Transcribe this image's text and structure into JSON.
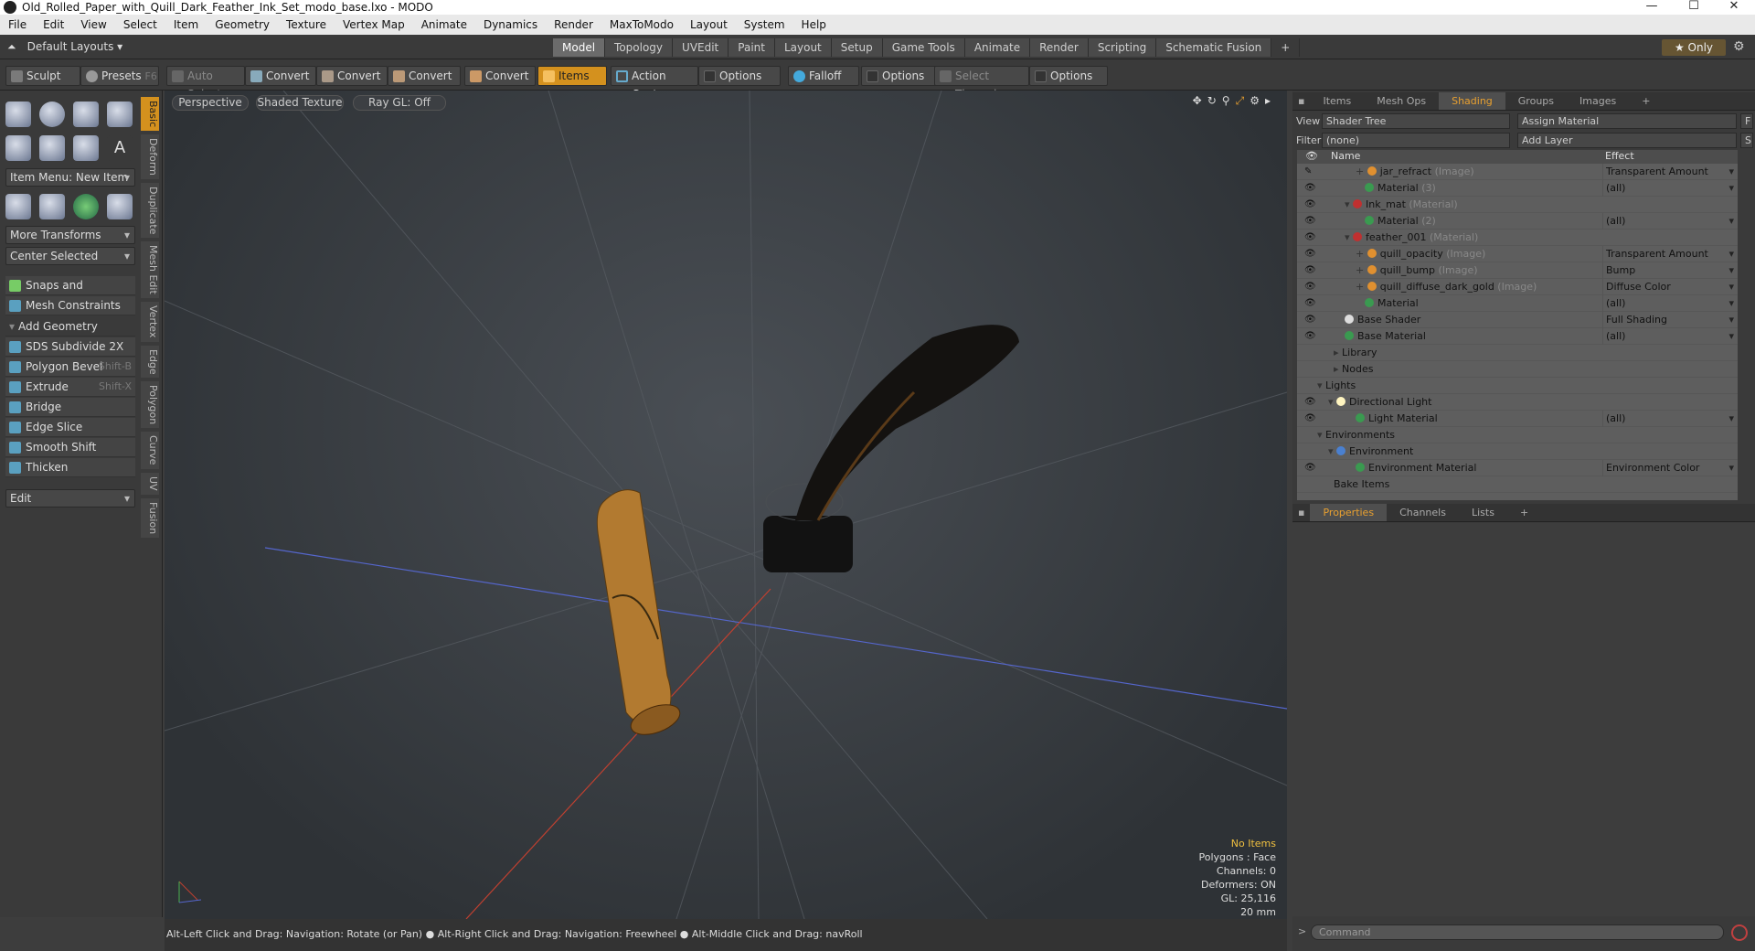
{
  "window": {
    "title": "Old_Rolled_Paper_with_Quill_Dark_Feather_Ink_Set_modo_base.lxo - MODO",
    "minimize": "—",
    "maximize": "☐",
    "close": "✕"
  },
  "menu": [
    "File",
    "Edit",
    "View",
    "Select",
    "Item",
    "Geometry",
    "Texture",
    "Vertex Map",
    "Animate",
    "Dynamics",
    "Render",
    "MaxToModo",
    "Layout",
    "System",
    "Help"
  ],
  "layout_selector": "Default Layouts ▾",
  "mode_tabs": [
    "Model",
    "Topology",
    "UVEdit",
    "Paint",
    "Layout",
    "Setup",
    "Game Tools",
    "Animate",
    "Render",
    "Scripting",
    "Schematic Fusion",
    "+"
  ],
  "only_label": "★ Only",
  "toolbar": {
    "sculpt": "Sculpt",
    "presets": "Presets",
    "presets_key": "F6",
    "auto_select": "Auto Select",
    "convert1": "Convert",
    "convert2": "Convert",
    "convert3": "Convert",
    "convert4": "Convert",
    "items": "Items",
    "action_center": "Action Center",
    "options1": "Options",
    "falloff": "Falloff",
    "options2": "Options",
    "select_through": "Select Through",
    "options3": "Options"
  },
  "left": {
    "vtabs": [
      "Basic",
      "Deform",
      "Duplicate",
      "Mesh Edit",
      "Vertex",
      "Edge",
      "Polygon",
      "Curve",
      "UV",
      "Fusion"
    ],
    "item_menu": "Item Menu: New Item",
    "more_transforms": "More Transforms",
    "center_selected": "Center Selected",
    "snaps": "Snaps and Precision",
    "mesh_constraints": "Mesh Constraints",
    "add_geometry": "Add Geometry",
    "tools": [
      {
        "label": "SDS Subdivide 2X",
        "key": ""
      },
      {
        "label": "Polygon Bevel",
        "key": "Shift-B"
      },
      {
        "label": "Extrude",
        "key": "Shift-X"
      },
      {
        "label": "Bridge",
        "key": ""
      },
      {
        "label": "Edge Slice",
        "key": ""
      },
      {
        "label": "Smooth Shift",
        "key": ""
      },
      {
        "label": "Thicken",
        "key": ""
      }
    ],
    "edit": "Edit"
  },
  "viewport": {
    "perspective": "Perspective",
    "shading": "Shaded Texture",
    "raygl": "Ray GL: Off",
    "hud": {
      "no_items": "No Items",
      "polygons": "Polygons : Face",
      "channels": "Channels: 0",
      "deformers": "Deformers: ON",
      "gl": "GL: 25,116",
      "scale": "20 mm"
    }
  },
  "status_text": "Alt-Left Click and Drag: Navigation: Rotate (or Pan) ● Alt-Right Click and Drag: Navigation: Freewheel ● Alt-Middle Click and Drag: navRoll",
  "right": {
    "tabs": [
      "Items",
      "Mesh Ops",
      "Shading",
      "Groups",
      "Images",
      "+"
    ],
    "view_label": "View",
    "view_value": "Shader Tree",
    "assign_material": "Assign Material",
    "f_btn": "F",
    "filter_label": "Filter",
    "filter_value": "(none)",
    "add_layer": "Add Layer",
    "s_btn": "S",
    "col_name": "Name",
    "col_effect": "Effect",
    "rows": [
      {
        "name": "jar_refract",
        "type": "(Image)",
        "effect": "Transparent Amount"
      },
      {
        "name": "Material",
        "type": "(3)",
        "effect": "(all)"
      },
      {
        "name": "Ink_mat",
        "type": "(Material)",
        "effect": ""
      },
      {
        "name": "Material",
        "type": "(2)",
        "effect": "(all)"
      },
      {
        "name": "feather_001",
        "type": "(Material)",
        "effect": ""
      },
      {
        "name": "quill_opacity",
        "type": "(Image)",
        "effect": "Transparent Amount"
      },
      {
        "name": "quill_bump",
        "type": "(Image)",
        "effect": "Bump"
      },
      {
        "name": "quill_diffuse_dark_gold",
        "type": "(Image)",
        "effect": "Diffuse Color"
      },
      {
        "name": "Material",
        "type": "",
        "effect": "(all)"
      },
      {
        "name": "Base Shader",
        "type": "",
        "effect": "Full Shading"
      },
      {
        "name": "Base Material",
        "type": "",
        "effect": "(all)"
      },
      {
        "name": "Library",
        "type": "",
        "effect": ""
      },
      {
        "name": "Nodes",
        "type": "",
        "effect": ""
      },
      {
        "name": "Lights",
        "type": "",
        "effect": ""
      },
      {
        "name": "Directional Light",
        "type": "",
        "effect": ""
      },
      {
        "name": "Light Material",
        "type": "",
        "effect": "(all)"
      },
      {
        "name": "Environments",
        "type": "",
        "effect": ""
      },
      {
        "name": "Environment",
        "type": "",
        "effect": ""
      },
      {
        "name": "Environment Material",
        "type": "",
        "effect": "Environment Color"
      },
      {
        "name": "Bake Items",
        "type": "",
        "effect": ""
      }
    ],
    "bottom_tabs": [
      "Properties",
      "Channels",
      "Lists",
      "+"
    ],
    "command_placeholder": "Command"
  }
}
